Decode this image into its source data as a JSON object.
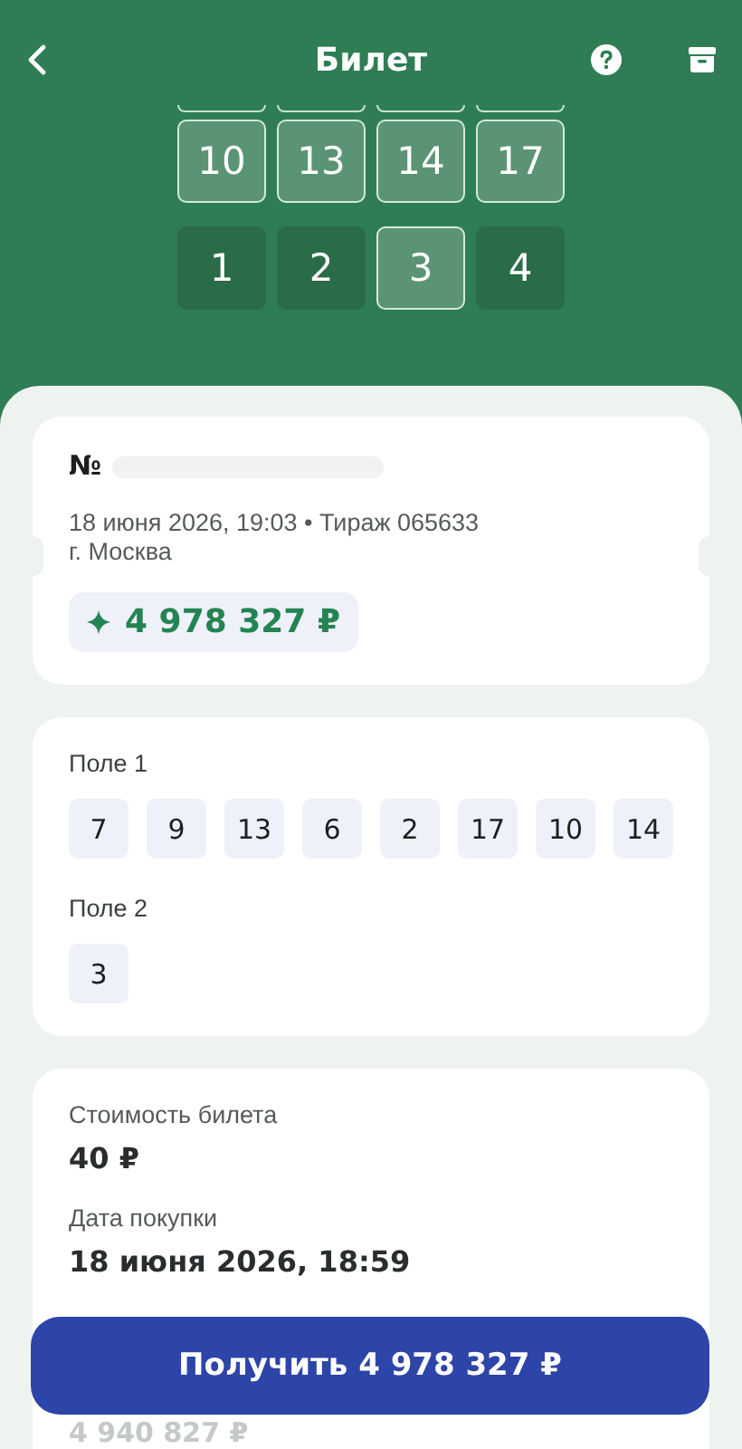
{
  "header": {
    "title": "Билет"
  },
  "selection": {
    "rows": [
      [
        {
          "label": "10",
          "selected": true
        },
        {
          "label": "13",
          "selected": true
        },
        {
          "label": "14",
          "selected": true
        },
        {
          "label": "17",
          "selected": true
        }
      ],
      [
        {
          "label": "1",
          "selected": false
        },
        {
          "label": "2",
          "selected": false
        },
        {
          "label": "3",
          "selected": true
        },
        {
          "label": "4",
          "selected": false
        }
      ]
    ]
  },
  "ticket": {
    "number_label": "№",
    "draw_info": "18 июня 2026, 19:03 • Тираж 065633",
    "city": "г. Москва",
    "prize": "4 978 327 ₽"
  },
  "fields": [
    {
      "title": "Поле 1",
      "numbers": [
        "7",
        "9",
        "13",
        "6",
        "2",
        "17",
        "10",
        "14"
      ]
    },
    {
      "title": "Поле 2",
      "numbers": [
        "3"
      ]
    }
  ],
  "details": [
    {
      "label": "Стоимость билета",
      "value": "40 ₽"
    },
    {
      "label": "Дата покупки",
      "value": "18 июня 2026, 18:59"
    }
  ],
  "partial_value": "4 940 827 ₽",
  "action_button": {
    "label": "Получить 4 978 327 ₽"
  }
}
